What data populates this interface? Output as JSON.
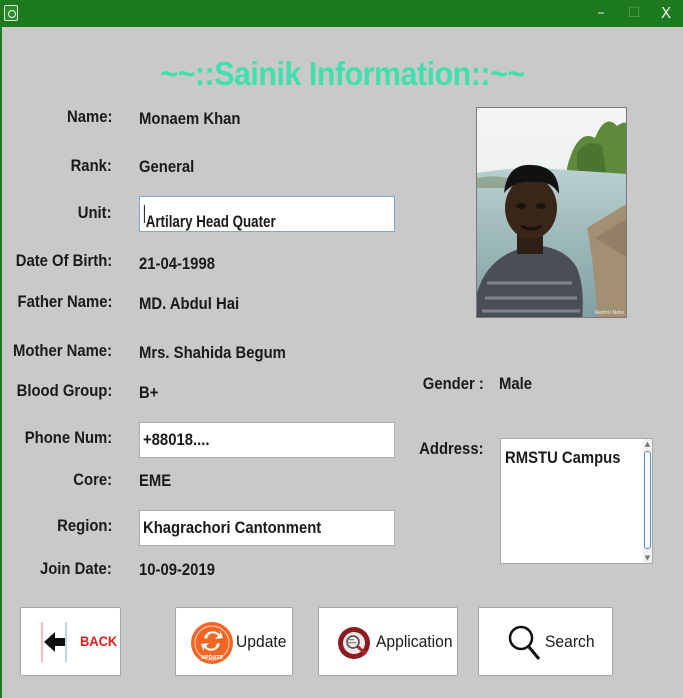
{
  "window": {
    "title": "",
    "controls": {
      "minimize": "–",
      "maximize": "☐",
      "close": "X"
    }
  },
  "heading": "~~::Sainik Information::~~",
  "fields": {
    "name": {
      "label": "Name:",
      "value": "Monaem Khan"
    },
    "rank": {
      "label": "Rank:",
      "value": "General"
    },
    "unit": {
      "label": "Unit:",
      "value": "Artilary Head Quater"
    },
    "dob": {
      "label": "Date Of Birth:",
      "value": "21-04-1998"
    },
    "father": {
      "label": "Father Name:",
      "value": "MD. Abdul Hai"
    },
    "mother": {
      "label": "Mother Name:",
      "value": "Mrs. Shahida Begum"
    },
    "blood": {
      "label": "Blood Group:",
      "value": "B+"
    },
    "phone": {
      "label": "Phone Num:",
      "value": "+88018...."
    },
    "core": {
      "label": "Core:",
      "value": "EME"
    },
    "region": {
      "label": "Region:",
      "value": "Khagrachori Cantonment"
    },
    "join": {
      "label": "Join Date:",
      "value": "10-09-2019"
    },
    "gender": {
      "label": "Gender :",
      "value": "Male"
    },
    "address": {
      "label": "Address:",
      "value": "RMSTU Campus"
    }
  },
  "buttons": {
    "back": {
      "label": "BACK",
      "icon": "back-arrow-icon"
    },
    "update": {
      "label": "Update",
      "icon": "update-icon",
      "icon_text": "UPDATE"
    },
    "application": {
      "label": "Application",
      "icon": "application-icon"
    },
    "search": {
      "label": "Search",
      "icon": "search-icon"
    }
  },
  "colors": {
    "titlebar": "#1e7a1e",
    "heading": "#3fdfae",
    "background": "#c9c9c9",
    "back_text": "#e11d1d",
    "update_orange": "#f26522"
  }
}
